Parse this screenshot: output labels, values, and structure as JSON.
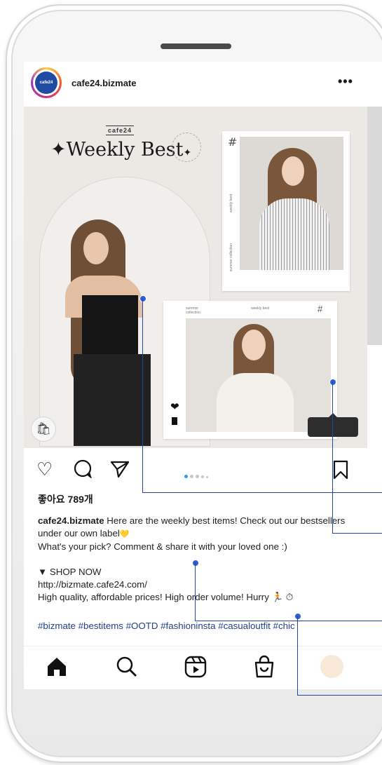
{
  "post": {
    "account_name": "cafe24.bizmate",
    "avatar_text": "cafe24",
    "more_label": "•••",
    "image": {
      "brand": "cafe24",
      "title_left_star": "✦",
      "title": "Weekly Best",
      "title_right_star": "✦",
      "card1_hash": "#",
      "card1_side_top": "weekly best",
      "card1_side_bottom": "summer collection",
      "card2_label_left": "summer collection",
      "card2_label_mid": "weekly best",
      "card2_hash": "#"
    },
    "likes": "좋아요 789개",
    "caption": {
      "username": "cafe24.bizmate",
      "line1": " Here are the weekly best items! Check out our bestsellers under our own label",
      "heart_emoji": "💛",
      "line2": "What's your pick? Comment & share it with your loved one :)",
      "shop_now": "▼ SHOP NOW",
      "url": "http://bizmate.cafe24.com/",
      "line3": "High quality, affordable prices! High order volume! Hurry 🏃 ⏱"
    },
    "hashtags": "#bizmate #bestitems #OOTD #fashioninsta #casualoutfit #chic",
    "carousel": {
      "count": 5,
      "active_index": 0
    }
  },
  "icons": {
    "like": "heart-outline-icon",
    "comment": "comment-icon",
    "share": "paper-plane-icon",
    "save": "bookmark-icon",
    "shopping_bag": "shopping-bag-icon",
    "home": "home-icon",
    "search": "search-icon",
    "reels": "reels-icon",
    "shop": "shop-icon"
  },
  "colors": {
    "hashtag": "#1f3f8f",
    "annotation": "#1f45a8",
    "carousel_active": "#3897f0"
  }
}
